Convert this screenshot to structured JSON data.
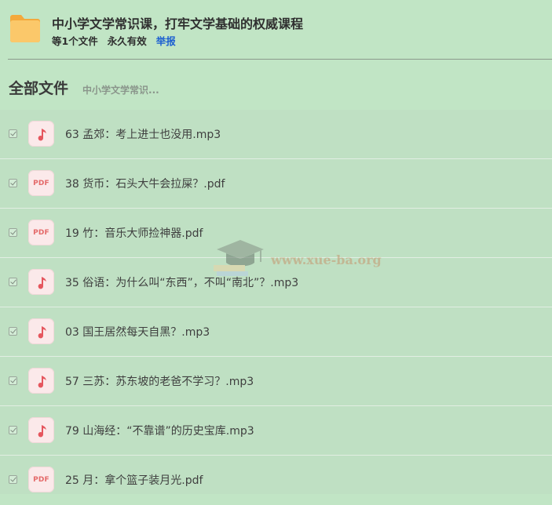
{
  "share": {
    "title": "中小学文学常识课，打牢文学基础的权威课程",
    "file_count": "等1个文件",
    "validity": "永久有效",
    "report_label": "举报"
  },
  "breadcrumb": {
    "root": "全部文件",
    "current": "中小学文学常识..."
  },
  "files": [
    {
      "name": "63 孟郊：考上进士也没用.mp3",
      "type": "mp3"
    },
    {
      "name": "38 货币：石头大牛会拉屎？.pdf",
      "type": "pdf"
    },
    {
      "name": "19 竹：音乐大师捡神器.pdf",
      "type": "pdf"
    },
    {
      "name": "35 俗语：为什么叫“东西”，不叫“南北”？.mp3",
      "type": "mp3"
    },
    {
      "name": "03 国王居然每天自黑？.mp3",
      "type": "mp3"
    },
    {
      "name": "57 三苏：苏东坡的老爸不学习？.mp3",
      "type": "mp3"
    },
    {
      "name": "79 山海经：“不靠谱”的历史宝库.mp3",
      "type": "mp3"
    },
    {
      "name": "25 月：拿个篮子装月光.pdf",
      "type": "pdf"
    }
  ],
  "file_icon_labels": {
    "pdf": "PDF"
  },
  "watermark": {
    "text": "www.xue-ba.org"
  },
  "colors": {
    "background": "#c1e5c5",
    "list_background": "#bfe0c3",
    "link": "#1b5fd1",
    "music_icon": "#e5565e",
    "folder": "#f8be5a"
  }
}
